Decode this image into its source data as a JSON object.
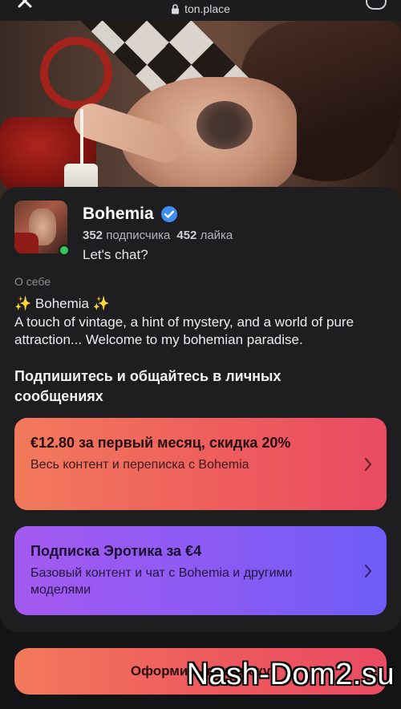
{
  "browser": {
    "url": "ton.place"
  },
  "profile": {
    "name": "Bohemia",
    "subscribers_count": "352",
    "subscribers_label": "подписчика",
    "likes_count": "452",
    "likes_label": "лайка",
    "status": "Let's chat?"
  },
  "about": {
    "label": "О себе",
    "emoji_line_prefix": "✨",
    "emoji_line_text": "Bohemia",
    "emoji_line_suffix": "✨",
    "text": "A touch of vintage, a hint of mystery, and a world of pure attraction... Welcome to my bohemian paradise."
  },
  "subscribe": {
    "title": "Подпишитесь и общайтесь в личных сообщениях",
    "plans": [
      {
        "title": "€12.80 за первый месяц, скидка 20%",
        "description": "Весь контент и переписка с Bohemia"
      },
      {
        "title": "Подписка Эротика за €4",
        "description": "Базовый контент и чат с Bohemia и другими моделями"
      }
    ],
    "cta_label": "Оформить подписку"
  },
  "watermark": "Nash-Dom2.su",
  "colors": {
    "background": "#141416",
    "card": "#1e1e20",
    "plan1_accent": "#ee5b5d",
    "plan2_accent": "#8a5bf4",
    "verified": "#3d8ef0",
    "online": "#34c759"
  },
  "icons": [
    "close-icon",
    "lock-icon",
    "verified-icon",
    "chevron-right-icon"
  ]
}
